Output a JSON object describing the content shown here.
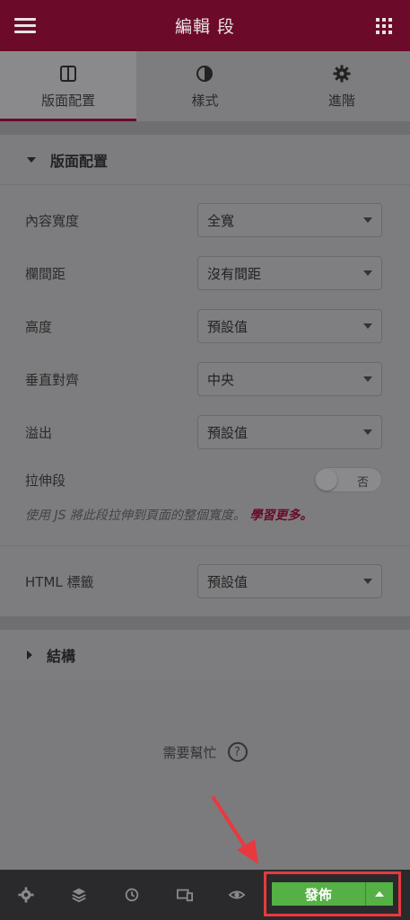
{
  "header": {
    "title": "編輯 段"
  },
  "tabs": [
    {
      "label": "版面配置",
      "icon": "columns-icon",
      "active": true
    },
    {
      "label": "樣式",
      "icon": "half-circle-icon",
      "active": false
    },
    {
      "label": "進階",
      "icon": "gear-icon",
      "active": false
    }
  ],
  "layout_section": {
    "title": "版面配置",
    "fields": [
      {
        "label": "內容寬度",
        "value": "全寬"
      },
      {
        "label": "欄間距",
        "value": "沒有間距"
      },
      {
        "label": "高度",
        "value": "預設值"
      },
      {
        "label": "垂直對齊",
        "value": "中央"
      },
      {
        "label": "溢出",
        "value": "預設值"
      }
    ],
    "stretch": {
      "label": "拉伸段",
      "toggle_text": "否"
    },
    "hint_text": "使用 JS 將此段拉伸到頁面的整個寬度。",
    "hint_link": "學習更多。",
    "html_tag": {
      "label": "HTML 標籤",
      "value": "預設值"
    }
  },
  "structure_section": {
    "title": "結構"
  },
  "help": {
    "label": "需要幫忙",
    "icon_text": "?"
  },
  "footer": {
    "icons": [
      "settings-icon",
      "layers-icon",
      "history-icon",
      "responsive-icon",
      "eye-icon"
    ],
    "publish_label": "發佈"
  },
  "colors": {
    "header_bg": "#6b0a29",
    "publish_green": "#55b046",
    "highlight_red": "#e8393f"
  }
}
